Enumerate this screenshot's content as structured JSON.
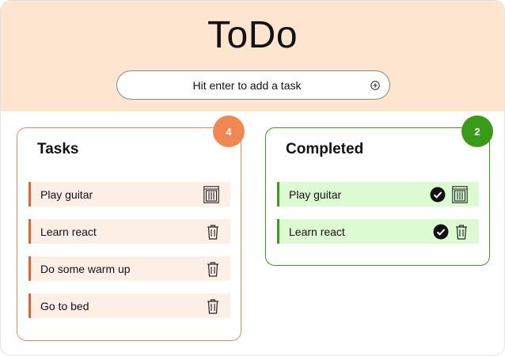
{
  "app": {
    "title": "ToDo"
  },
  "add_task": {
    "placeholder": "Hit enter to add a task"
  },
  "tasks": {
    "title": "Tasks",
    "count": "4",
    "items": [
      {
        "label": "Play guitar"
      },
      {
        "label": "Learn react"
      },
      {
        "label": "Do some warm up"
      },
      {
        "label": "Go to bed"
      }
    ]
  },
  "completed": {
    "title": "Completed",
    "count": "2",
    "items": [
      {
        "label": "Play guitar"
      },
      {
        "label": "Learn react"
      }
    ]
  },
  "icons": {
    "add": "plus-circle-icon",
    "delete": "trash-icon",
    "done": "check-circle-icon"
  },
  "colors": {
    "header_bg": "#fde5cf",
    "tasks_accent": "#ef8852",
    "tasks_item_bg": "#fdeee6",
    "completed_accent": "#3c9a1a",
    "completed_item_bg": "#dcfbd3"
  }
}
